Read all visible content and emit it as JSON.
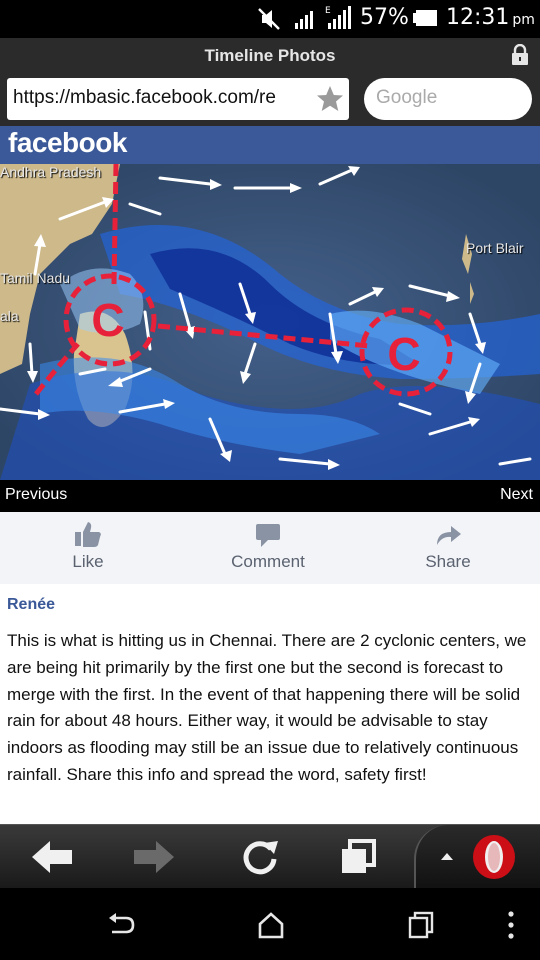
{
  "status_bar": {
    "battery_text": "57%",
    "time": "12:31",
    "ampm": "pm",
    "network": "E"
  },
  "browser": {
    "title": "Timeline Photos",
    "url": "https://mbasic.facebook.com/re",
    "search_placeholder": "Google"
  },
  "facebook": {
    "logo": "facebook"
  },
  "photo": {
    "labels": [
      "Andhra Pradesh",
      "Tamil Nadu",
      "Port Blair",
      "ala"
    ],
    "cyclone_marker": "C"
  },
  "pager": {
    "previous": "Previous",
    "next": "Next"
  },
  "actions": {
    "like": "Like",
    "comment": "Comment",
    "share": "Share"
  },
  "post": {
    "author": "Renée",
    "text": "This is what is hitting us in Chennai.  There are 2 cyclonic centers, we are being hit primarily  by the first  one but the second is forecast  to merge with  the first.  In the event  of that happening  there will be solid rain for about 48 hours. Either way, it would be advisable  to stay indoors as  flooding may still be an issue due to relatively  continuous  rainfall. Share this  info and spread  the word,  safety first!"
  },
  "icons": {
    "status": [
      "mute-icon",
      "signal-icon",
      "battery-icon"
    ],
    "toolbar": [
      "back-arrow-icon",
      "forward-arrow-icon",
      "reload-icon",
      "tabs-icon",
      "opera-menu-icon"
    ],
    "nav": [
      "nav-back-icon",
      "nav-home-icon",
      "nav-recents-icon",
      "nav-menu-icon"
    ]
  },
  "colors": {
    "facebook_blue": "#3b5998",
    "cyclone_red": "#e8213a",
    "opera_red": "#cc0f16"
  }
}
